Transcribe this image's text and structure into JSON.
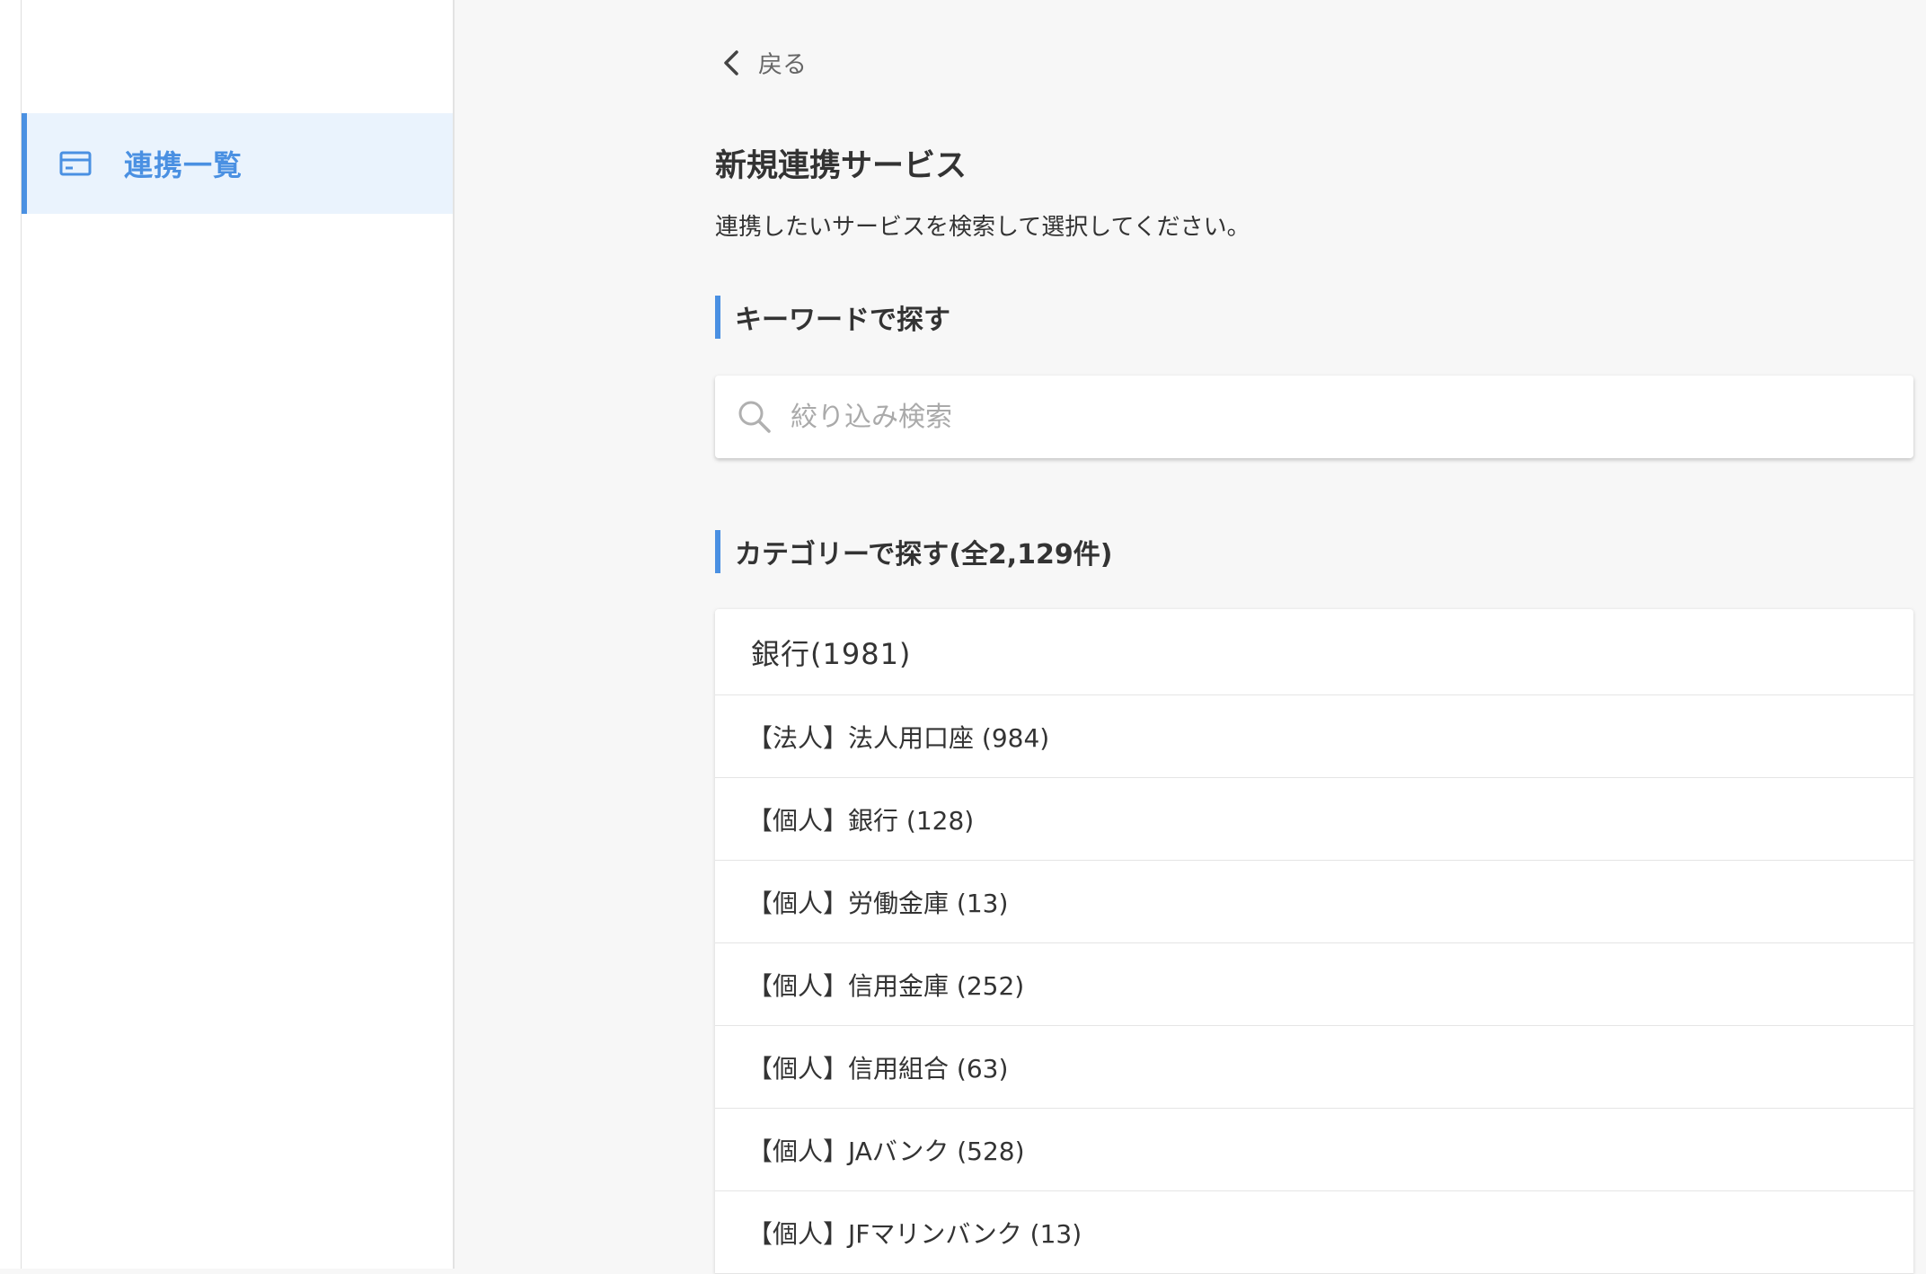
{
  "sidebar": {
    "items": [
      {
        "label": "連携一覧",
        "icon": "card-icon",
        "active": true
      }
    ]
  },
  "main": {
    "back_label": "戻る",
    "title": "新規連携サービス",
    "description": "連携したいサービスを検索して選択してください。",
    "keyword_section": {
      "heading": "キーワードで探す",
      "search_placeholder": "絞り込み検索",
      "search_value": ""
    },
    "category_section": {
      "heading": "カテゴリーで探す(全2,129件)",
      "groups": [
        {
          "title": "銀行(1981)",
          "items": [
            {
              "label": "【法人】法人用口座 (984)"
            },
            {
              "label": "【個人】銀行 (128)"
            },
            {
              "label": "【個人】労働金庫 (13)"
            },
            {
              "label": "【個人】信用金庫 (252)"
            },
            {
              "label": "【個人】信用組合 (63)"
            },
            {
              "label": "【個人】JAバンク (528)"
            },
            {
              "label": "【個人】JFマリンバンク (13)"
            }
          ]
        }
      ]
    }
  },
  "colors": {
    "accent": "#4a90e2",
    "active_bg": "#eaf3fd",
    "page_bg": "#f7f7f7",
    "text": "#333333"
  }
}
